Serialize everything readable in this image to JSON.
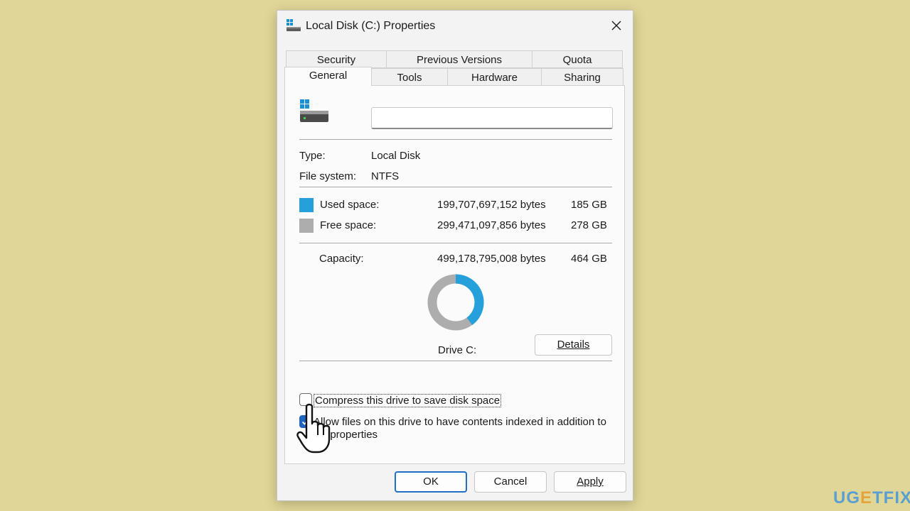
{
  "window": {
    "title": "Local Disk (C:) Properties"
  },
  "tabs": {
    "row1": [
      "Security",
      "Previous Versions",
      "Quota"
    ],
    "row2": [
      "General",
      "Tools",
      "Hardware",
      "Sharing"
    ],
    "active": "General"
  },
  "general": {
    "drive_name_value": "",
    "type_label": "Type:",
    "type_value": "Local Disk",
    "fs_label": "File system:",
    "fs_value": "NTFS",
    "used": {
      "label": "Used space:",
      "bytes": "199,707,697,152 bytes",
      "size": "185 GB",
      "color": "#26a0da"
    },
    "free": {
      "label": "Free space:",
      "bytes": "299,471,097,856 bytes",
      "size": "278 GB",
      "color": "#adadad"
    },
    "capacity": {
      "label": "Capacity:",
      "bytes": "499,178,795,008 bytes",
      "size": "464 GB"
    },
    "used_fraction": 0.4001,
    "drive_label": "Drive C:",
    "details_label": "Details",
    "compress_label": "Compress this drive to save disk space",
    "compress_checked": false,
    "index_label_line1": "Allow files on this drive to have contents indexed in addition to",
    "index_label_line2": "file properties",
    "index_checked": true
  },
  "buttons": {
    "ok": "OK",
    "cancel": "Cancel",
    "apply": "Apply"
  },
  "watermark": {
    "part1": "UG",
    "part2": "E",
    "part3": "TFIX"
  }
}
